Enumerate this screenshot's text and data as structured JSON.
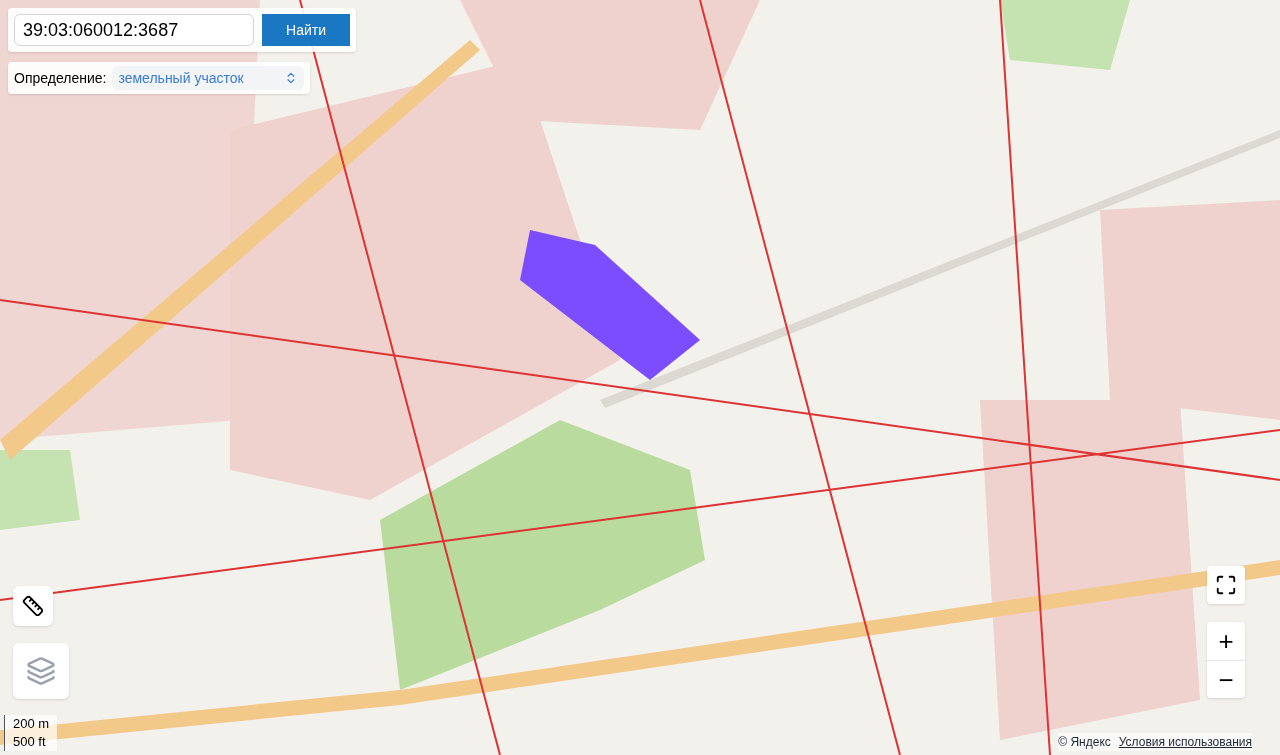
{
  "search": {
    "value": "39:03:060012:3687",
    "button": "Найти"
  },
  "definition": {
    "label": "Определение:",
    "value": "земельный участок"
  },
  "scale": [
    "200 m",
    "500 ft"
  ],
  "zoom_controls": {
    "plus": "+",
    "minus": "−"
  },
  "footer": {
    "copyright": "© Яндекс",
    "terms": "Условия использования"
  }
}
